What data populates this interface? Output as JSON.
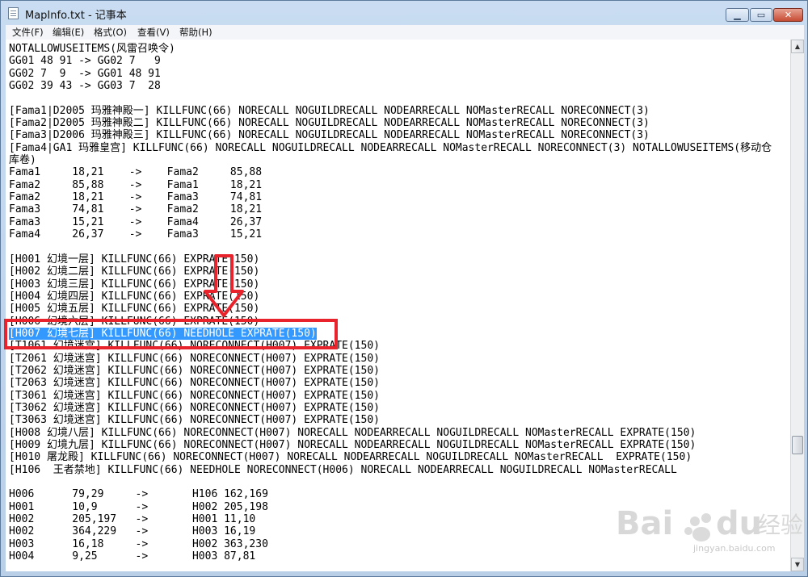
{
  "window": {
    "title": "MapInfo.txt - 记事本",
    "controls": {
      "minimize": "▁",
      "maximize": "▭",
      "close": "✕"
    }
  },
  "menu": [
    "文件(F)",
    "编辑(E)",
    "格式(O)",
    "查看(V)",
    "帮助(H)"
  ],
  "document": {
    "lines": [
      "NOTALLOWUSEITEMS(风雷召唤令)",
      "GG01 48 91 -> GG02 7   9",
      "GG02 7  9  -> GG01 48 91",
      "GG02 39 43 -> GG03 7  28",
      "",
      "[Fama1|D2005 玛雅神殿一] KILLFUNC(66) NORECALL NOGUILDRECALL NODEARRECALL NOMasterRECALL NORECONNECT(3)",
      "[Fama2|D2005 玛雅神殿二] KILLFUNC(66) NORECALL NOGUILDRECALL NODEARRECALL NOMasterRECALL NORECONNECT(3)",
      "[Fama3|D2006 玛雅神殿三] KILLFUNC(66) NORECALL NOGUILDRECALL NODEARRECALL NOMasterRECALL NORECONNECT(3)",
      "[Fama4|GA1 玛雅皇宫] KILLFUNC(66) NORECALL NOGUILDRECALL NODEARRECALL NOMasterRECALL NORECONNECT(3) NOTALLOWUSEITEMS(移动仓",
      "库卷)",
      "Fama1     18,21    ->    Fama2     85,88",
      "Fama2     85,88    ->    Fama1     18,21",
      "Fama2     18,21    ->    Fama3     74,81",
      "Fama3     74,81    ->    Fama2     18,21",
      "Fama3     15,21    ->    Fama4     26,37",
      "Fama4     26,37    ->    Fama3     15,21",
      "",
      "[H001 幻境一层] KILLFUNC(66) EXPRATE(150)",
      "[H002 幻境二层] KILLFUNC(66) EXPRATE(150)",
      "[H003 幻境三层] KILLFUNC(66) EXPRATE(150)",
      "[H004 幻境四层] KILLFUNC(66) EXPRATE(150)",
      "[H005 幻境五层] KILLFUNC(66) EXPRATE(150)",
      "[H006 幻境六层] KILLFUNC(66) EXPRATE(150)",
      "[H007 幻境七层] KILLFUNC(66) NEEDHOLE EXPRATE(150)",
      "[T1061 幻境迷宫] KILLFUNC(66) NORECONNECT(H007) EXPRATE(150)",
      "[T2061 幻境迷宫] KILLFUNC(66) NORECONNECT(H007) EXPRATE(150)",
      "[T2062 幻境迷宫] KILLFUNC(66) NORECONNECT(H007) EXPRATE(150)",
      "[T2063 幻境迷宫] KILLFUNC(66) NORECONNECT(H007) EXPRATE(150)",
      "[T3061 幻境迷宫] KILLFUNC(66) NORECONNECT(H007) EXPRATE(150)",
      "[T3062 幻境迷宫] KILLFUNC(66) NORECONNECT(H007) EXPRATE(150)",
      "[T3063 幻境迷宫] KILLFUNC(66) NORECONNECT(H007) EXPRATE(150)",
      "[H008 幻境八层] KILLFUNC(66) NORECONNECT(H007) NORECALL NODEARRECALL NOGUILDRECALL NOMasterRECALL EXPRATE(150)",
      "[H009 幻境九层] KILLFUNC(66) NORECONNECT(H007) NORECALL NODEARRECALL NOGUILDRECALL NOMasterRECALL EXPRATE(150)",
      "[H010 屠龙殿] KILLFUNC(66) NORECONNECT(H007) NORECALL NODEARRECALL NOGUILDRECALL NOMasterRECALL  EXPRATE(150)",
      "[H106  王者禁地] KILLFUNC(66) NEEDHOLE NORECONNECT(H006) NORECALL NODEARRECALL NOGUILDRECALL NOMasterRECALL",
      "",
      "H006      79,29     ->       H106 162,169",
      "H001      10,9      ->       H002 205,198",
      "H002      205,197   ->       H001 11,10",
      "H002      364,229   ->       H003 16,19",
      "H003      16,18     ->       H002 363,230",
      "H004      9,25      ->       H003 87,81"
    ],
    "selected_line_index": 23
  },
  "watermark": {
    "brand": "Baidu经验",
    "url": "jingyan.baidu.com"
  },
  "colors": {
    "selection": "#3399ff",
    "annotation": "#e8232b"
  }
}
